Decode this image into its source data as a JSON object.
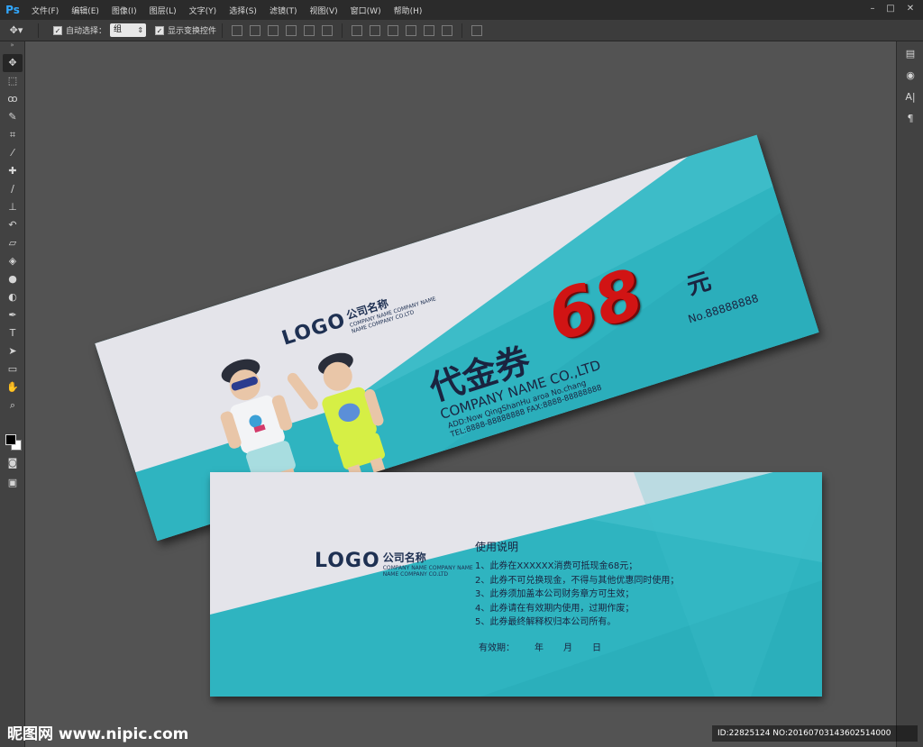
{
  "app": {
    "name": "Ps"
  },
  "menu": [
    "文件(F)",
    "编辑(E)",
    "图像(I)",
    "图层(L)",
    "文字(Y)",
    "选择(S)",
    "滤镜(T)",
    "视图(V)",
    "窗口(W)",
    "帮助(H)"
  ],
  "options_bar": {
    "tool_icon": "move-tool-icon",
    "auto_select_label": "自动选择：",
    "auto_select_value": "组",
    "show_transform_label": "显示变换控件"
  },
  "tools": [
    "move",
    "marquee",
    "lasso",
    "quick-select",
    "crop",
    "eyedropper",
    "healing",
    "brush",
    "stamp",
    "history-brush",
    "eraser",
    "paint-bucket",
    "blur",
    "dodge",
    "pen",
    "type",
    "path-select",
    "shape",
    "hand",
    "zoom"
  ],
  "colors": {
    "teal": "#2fb4c0",
    "light_gray": "#e4e4ea",
    "navy": "#1a2440",
    "red": "#d11414"
  },
  "voucher_front": {
    "logo": "LOGO",
    "company_cn": "公司名称",
    "company_sub_1": "COMPANY NAME COMPANY NAME",
    "company_sub_2": "NAME COMPANY CO.LTD",
    "title": "代金券",
    "amount": "68",
    "unit": "元",
    "company_name": "COMPANY NAME CO.,LTD",
    "address": "ADD:Now QingShanHu aroa No.chang",
    "tel_fax": "TEL:8888-88888888   FAX:8888-88888888",
    "number": "No.88888888"
  },
  "voucher_back": {
    "logo": "LOGO",
    "company_cn": "公司名称",
    "company_sub_1": "COMPANY NAME COMPANY NAME",
    "company_sub_2": "NAME COMPANY CO.LTD",
    "instructions_title": "使用说明",
    "instructions": [
      "1、此券在XXXXXX消费可抵现金68元；",
      "2、此券不可兑换现金，不得与其他优惠同时使用；",
      "3、此券须加盖本公司财务章方可生效；",
      "4、此券请在有效期内使用，过期作废；",
      "5、此券最终解释权归本公司所有。"
    ],
    "validity_label": "有效期：",
    "year": "年",
    "month": "月",
    "day": "日"
  },
  "watermark": {
    "left": "昵图网 www.nipic.com",
    "right": "ID:22825124 NO:20160703143602514000"
  }
}
